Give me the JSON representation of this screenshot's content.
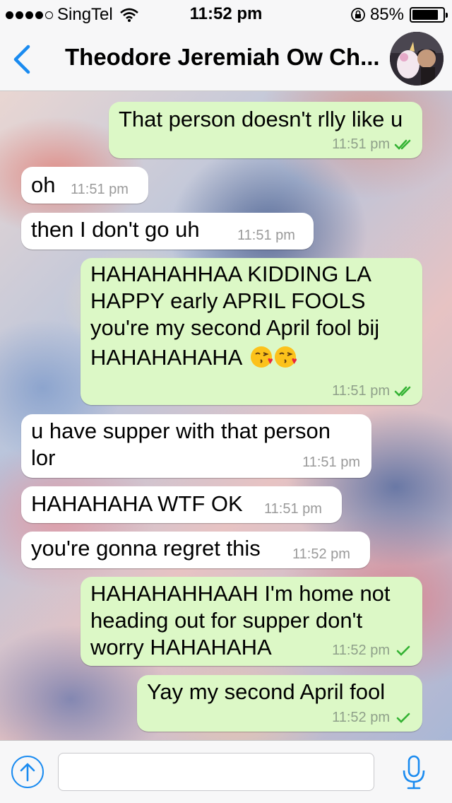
{
  "status_bar": {
    "carrier": "SingTel",
    "time": "11:52 pm",
    "battery_percent": "85%",
    "battery_level": 0.85,
    "signal_bars": 4
  },
  "nav": {
    "back_icon": "chevron-left-icon",
    "title": "Theodore Jeremiah Ow Ch..."
  },
  "messages": [
    {
      "direction": "out",
      "lines": [
        "That person doesn't rlly like u"
      ],
      "time": "11:51 pm",
      "ticks": "double"
    },
    {
      "direction": "in",
      "lines": [
        "oh"
      ],
      "time": "11:51 pm"
    },
    {
      "direction": "in",
      "lines": [
        "then I don't go uh"
      ],
      "time": "11:51 pm"
    },
    {
      "direction": "out",
      "lines": [
        "HAHAHAHHAA KIDDING LA",
        "HAPPY early APRIL FOOLS",
        "you're my second April fool bij",
        "HAHAHAHAHA"
      ],
      "emoji": "kissing-face-heart-emoji",
      "emoji_count": 2,
      "time": "11:51 pm",
      "ticks": "double"
    },
    {
      "direction": "in",
      "lines": [
        "u have supper with that person",
        "lor"
      ],
      "time": "11:51 pm"
    },
    {
      "direction": "in",
      "lines": [
        "HAHAHAHA WTF OK"
      ],
      "time": "11:51 pm"
    },
    {
      "direction": "in",
      "lines": [
        "you're gonna regret this"
      ],
      "time": "11:52 pm"
    },
    {
      "direction": "out",
      "lines": [
        "HAHAHAHHAAH I'm home not",
        "heading out for supper don't",
        "worry HAHAHAHA"
      ],
      "time": "11:52 pm",
      "ticks": "single"
    },
    {
      "direction": "out",
      "lines": [
        "Yay my second April fool"
      ],
      "time": "11:52 pm",
      "ticks": "single"
    }
  ],
  "input_bar": {
    "attach_icon": "upload-arrow-icon",
    "placeholder": "",
    "mic_icon": "microphone-icon"
  },
  "colors": {
    "accent": "#1a8bf0",
    "tick": "#34b233",
    "outgoing_bubble": "#dcf8c6",
    "incoming_bubble": "#ffffff"
  }
}
